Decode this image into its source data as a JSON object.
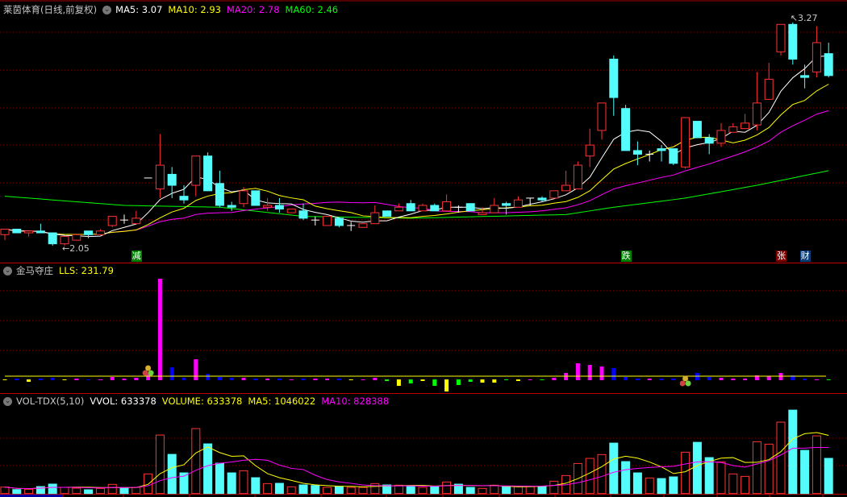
{
  "header": {
    "stock_title": "莱茵体育(日线,前复权)",
    "ma5_label": "MA5: 3.07",
    "ma10_label": "MA10: 2.93",
    "ma20_label": "MA20: 2.78",
    "ma60_label": "MA60: 2.46"
  },
  "indicator": {
    "name": "金马夺庄",
    "value_label": "LLS: 231.79"
  },
  "volume_header": {
    "name": "VOL-TDX(5,10)",
    "vvol_label": "VVOL: 633378",
    "volume_label": "VOLUME: 633378",
    "ma5_label": "MA5: 1046022",
    "ma10_label": "MA10: 828388"
  },
  "signals": {
    "jian": "减",
    "die": "跌",
    "zhang": "张",
    "cai": "财"
  },
  "price_marks": {
    "high_label": "3.27",
    "low_label": "2.05"
  },
  "colors": {
    "up": "#ff3232",
    "down": "#54fcfc",
    "ma5": "#ffffff",
    "ma10": "#ffff00",
    "ma20": "#ff00ff",
    "ma60": "#00ff00",
    "grid": "#8b0000"
  },
  "chart_data": {
    "type": "candlestick",
    "title": "莱茵体育(日线,前复权)",
    "ylim": [
      2.0,
      3.3
    ],
    "candles_ohlc": [
      [
        2.11,
        2.14,
        2.08,
        2.14
      ],
      [
        2.14,
        2.14,
        2.12,
        2.12
      ],
      [
        2.12,
        2.13,
        2.1,
        2.13
      ],
      [
        2.13,
        2.17,
        2.12,
        2.12
      ],
      [
        2.12,
        2.12,
        2.05,
        2.06
      ],
      [
        2.06,
        2.1,
        2.05,
        2.1
      ],
      [
        2.08,
        2.11,
        2.08,
        2.11
      ],
      [
        2.13,
        2.13,
        2.09,
        2.11
      ],
      [
        2.11,
        2.14,
        2.11,
        2.13
      ],
      [
        2.16,
        2.21,
        2.15,
        2.21
      ],
      [
        2.19,
        2.22,
        2.17,
        2.19
      ],
      [
        2.17,
        2.24,
        2.17,
        2.2
      ],
      [
        2.42,
        2.42,
        2.42,
        2.42
      ],
      [
        2.36,
        2.66,
        2.31,
        2.49
      ],
      [
        2.44,
        2.48,
        2.31,
        2.38
      ],
      [
        2.32,
        2.38,
        2.28,
        2.3
      ],
      [
        2.38,
        2.54,
        2.32,
        2.54
      ],
      [
        2.54,
        2.56,
        2.35,
        2.35
      ],
      [
        2.39,
        2.46,
        2.26,
        2.27
      ],
      [
        2.27,
        2.29,
        2.24,
        2.26
      ],
      [
        2.28,
        2.37,
        2.26,
        2.35
      ],
      [
        2.35,
        2.35,
        2.27,
        2.27
      ],
      [
        2.26,
        2.31,
        2.24,
        2.27
      ],
      [
        2.27,
        2.31,
        2.23,
        2.25
      ],
      [
        2.23,
        2.25,
        2.23,
        2.25
      ],
      [
        2.24,
        2.28,
        2.19,
        2.2
      ],
      [
        2.19,
        2.21,
        2.16,
        2.19
      ],
      [
        2.16,
        2.21,
        2.16,
        2.21
      ],
      [
        2.2,
        2.2,
        2.15,
        2.16
      ],
      [
        2.16,
        2.18,
        2.13,
        2.16
      ],
      [
        2.15,
        2.17,
        2.15,
        2.17
      ],
      [
        2.17,
        2.27,
        2.17,
        2.23
      ],
      [
        2.24,
        2.24,
        2.21,
        2.21
      ],
      [
        2.24,
        2.28,
        2.24,
        2.26
      ],
      [
        2.28,
        2.3,
        2.24,
        2.24
      ],
      [
        2.24,
        2.28,
        2.24,
        2.27
      ],
      [
        2.27,
        2.28,
        2.24,
        2.24
      ],
      [
        2.24,
        2.33,
        2.24,
        2.29
      ],
      [
        2.26,
        2.27,
        2.23,
        2.26
      ],
      [
        2.28,
        2.28,
        2.24,
        2.24
      ],
      [
        2.22,
        2.26,
        2.22,
        2.23
      ],
      [
        2.23,
        2.31,
        2.23,
        2.27
      ],
      [
        2.28,
        2.29,
        2.22,
        2.27
      ],
      [
        2.26,
        2.32,
        2.26,
        2.3
      ],
      [
        2.31,
        2.31,
        2.27,
        2.31
      ],
      [
        2.31,
        2.32,
        2.29,
        2.3
      ],
      [
        2.31,
        2.35,
        2.31,
        2.35
      ],
      [
        2.35,
        2.46,
        2.35,
        2.38
      ],
      [
        2.36,
        2.51,
        2.36,
        2.49
      ],
      [
        2.54,
        2.69,
        2.48,
        2.6
      ],
      [
        2.68,
        2.83,
        2.63,
        2.83
      ],
      [
        3.07,
        3.09,
        2.76,
        2.86
      ],
      [
        2.8,
        2.82,
        2.57,
        2.57
      ],
      [
        2.57,
        2.62,
        2.49,
        2.55
      ],
      [
        2.55,
        2.57,
        2.51,
        2.55
      ],
      [
        2.58,
        2.6,
        2.51,
        2.57
      ],
      [
        2.58,
        2.58,
        2.49,
        2.5
      ],
      [
        2.48,
        2.75,
        2.47,
        2.75
      ],
      [
        2.73,
        2.73,
        2.64,
        2.64
      ],
      [
        2.64,
        2.66,
        2.55,
        2.61
      ],
      [
        2.61,
        2.72,
        2.59,
        2.68
      ],
      [
        2.67,
        2.72,
        2.67,
        2.7
      ],
      [
        2.69,
        2.77,
        2.69,
        2.72
      ],
      [
        2.71,
        3.0,
        2.68,
        2.83
      ],
      [
        2.85,
        3.05,
        2.85,
        2.96
      ],
      [
        3.11,
        3.26,
        3.09,
        3.26
      ],
      [
        3.26,
        3.27,
        3.04,
        3.07
      ],
      [
        2.98,
        3.04,
        2.91,
        2.97
      ],
      [
        3.0,
        3.25,
        2.97,
        3.16
      ],
      [
        3.1,
        3.16,
        2.97,
        2.98
      ]
    ],
    "ma60_anchors": [
      [
        0,
        2.32
      ],
      [
        10,
        2.27
      ],
      [
        18,
        2.26
      ],
      [
        25,
        2.21
      ],
      [
        34,
        2.2
      ],
      [
        47,
        2.22
      ],
      [
        51,
        2.26
      ],
      [
        57,
        2.31
      ],
      [
        63,
        2.38
      ],
      [
        69,
        2.46
      ]
    ],
    "high_index": 66,
    "low_index": 5,
    "signal_indices": {
      "jian": 11,
      "die": 52,
      "zhang": 65,
      "cai": 67
    },
    "indicator_bars": {
      "ylim": [
        -20,
        130
      ],
      "reference_line": 5,
      "values": [
        -1,
        2,
        -3,
        2,
        3,
        -1,
        2,
        1,
        1,
        4,
        2,
        3,
        8,
        126,
        16,
        3,
        26,
        8,
        4,
        3,
        3,
        2,
        2,
        2,
        1,
        2,
        2,
        2,
        2,
        -1,
        1,
        3,
        -2,
        -8,
        -5,
        -2,
        -8,
        -15,
        -7,
        -3,
        -4,
        -4,
        -1,
        -2,
        1,
        -1,
        3,
        9,
        21,
        19,
        17,
        15,
        4,
        2,
        2,
        2,
        2,
        0,
        9,
        4,
        3,
        2,
        2,
        6,
        5,
        9,
        6,
        2,
        1,
        -1
      ],
      "colors": "ybybbymbmmmmmmbbmbbbmbmbmbmmbymmgygygyggyygymgmmmmmbbbmbbxbbmmmmmmbbmg",
      "marker_indices": [
        12,
        57
      ]
    },
    "volume": {
      "ylim": [
        0,
        1600000
      ],
      "values": [
        116000,
        72000,
        77000,
        125000,
        170000,
        110000,
        97000,
        68000,
        92000,
        165000,
        106000,
        110000,
        353000,
        1053000,
        705000,
        372000,
        1169000,
        894000,
        546000,
        372000,
        411000,
        285000,
        179000,
        184000,
        121000,
        155000,
        145000,
        111000,
        130000,
        111000,
        111000,
        179000,
        155000,
        150000,
        135000,
        111000,
        121000,
        208000,
        169000,
        111000,
        92000,
        150000,
        130000,
        125000,
        125000,
        130000,
        222000,
        324000,
        541000,
        633000,
        701000,
        908000,
        575000,
        372000,
        280000,
        270000,
        300000,
        744000,
        922000,
        647000,
        570000,
        353000,
        309000,
        932000,
        889000,
        1285000,
        1502000,
        777000,
        1038000,
        633378
      ],
      "up": "rcrccrrcrrcrrrccrcccrcrcrccrcrrrcrcrcrccrrcrrcrrrrrcccrccrccrrrrrrccrc"
    }
  }
}
